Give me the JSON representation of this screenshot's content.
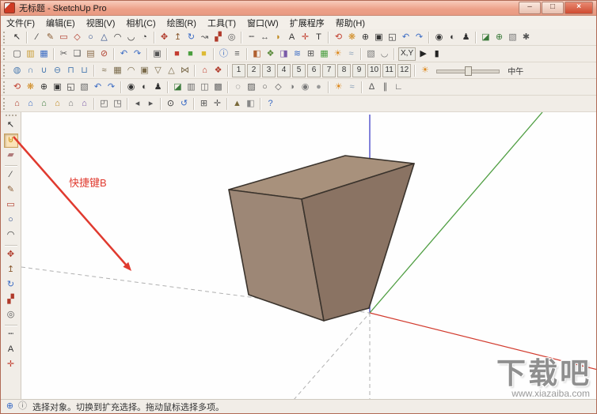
{
  "window": {
    "title": "无标题 - SketchUp Pro",
    "controls": {
      "minimize": "–",
      "maximize": "□",
      "close": "×"
    }
  },
  "menu": {
    "items": [
      {
        "n": "menu-file",
        "g": "文件(F)"
      },
      {
        "n": "menu-edit",
        "g": "编辑(E)"
      },
      {
        "n": "menu-view",
        "g": "视图(V)"
      },
      {
        "n": "menu-camera",
        "g": "相机(C)"
      },
      {
        "n": "menu-draw",
        "g": "绘图(R)"
      },
      {
        "n": "menu-tools",
        "g": "工具(T)"
      },
      {
        "n": "menu-window",
        "g": "窗口(W)"
      },
      {
        "n": "menu-extensions",
        "g": "扩展程序"
      },
      {
        "n": "menu-help",
        "g": "帮助(H)"
      }
    ]
  },
  "toolbars": {
    "row1": [
      {
        "grip": true
      },
      {
        "n": "select-tool",
        "g": "↖",
        "c": "#222222"
      },
      {
        "sep": true
      },
      {
        "n": "line-tool",
        "g": "∕",
        "c": "#333333"
      },
      {
        "n": "freehand-tool",
        "g": "✎",
        "c": "#8a5a30"
      },
      {
        "n": "rectangle-tool",
        "g": "▭",
        "c": "#b03a2a"
      },
      {
        "n": "rotated-rectangle-tool",
        "g": "◇",
        "c": "#b03a2a"
      },
      {
        "n": "circle-tool",
        "g": "○",
        "c": "#2a4a8a"
      },
      {
        "n": "polygon-tool",
        "g": "△",
        "c": "#2a4a8a"
      },
      {
        "n": "arc-tool",
        "g": "◠",
        "c": "#333333"
      },
      {
        "n": "two-point-arc-tool",
        "g": "◡",
        "c": "#333333"
      },
      {
        "n": "pie-tool",
        "g": "◔",
        "c": "#333333"
      },
      {
        "sep": true
      },
      {
        "n": "move-tool",
        "g": "✥",
        "c": "#b03a2a"
      },
      {
        "n": "push-pull-tool",
        "g": "↥",
        "c": "#8a5a30"
      },
      {
        "n": "rotate-tool",
        "g": "↻",
        "c": "#3a6bc4"
      },
      {
        "n": "follow-me-tool",
        "g": "↝",
        "c": "#555555"
      },
      {
        "n": "scale-tool",
        "g": "▞",
        "c": "#b03a2a"
      },
      {
        "n": "offset-tool",
        "g": "◎",
        "c": "#555555"
      },
      {
        "sep": true
      },
      {
        "n": "tape-measure-tool",
        "g": "┉",
        "c": "#555555"
      },
      {
        "n": "dimension-tool",
        "g": "↔",
        "c": "#555555"
      },
      {
        "n": "protractor-tool",
        "g": "◗",
        "c": "#c08a20"
      },
      {
        "n": "text-tool",
        "g": "A",
        "c": "#333333"
      },
      {
        "n": "axes-tool",
        "g": "✛",
        "c": "#c03a2a"
      },
      {
        "n": "3d-text-tool",
        "g": "T",
        "c": "#333333"
      },
      {
        "sep": true
      },
      {
        "n": "orbit-tool",
        "g": "⟲",
        "c": "#c03a2a"
      },
      {
        "n": "pan-tool",
        "g": "❋",
        "c": "#d08a20"
      },
      {
        "n": "zoom-tool",
        "g": "⊕",
        "c": "#333333"
      },
      {
        "n": "zoom-window-tool",
        "g": "▣",
        "c": "#333333"
      },
      {
        "n": "zoom-extents-tool",
        "g": "◱",
        "c": "#333333"
      },
      {
        "n": "previous-view-button",
        "g": "↶",
        "c": "#3a6bc4"
      },
      {
        "n": "next-view-button",
        "g": "↷",
        "c": "#3a6bc4"
      },
      {
        "sep": true
      },
      {
        "n": "position-camera-tool",
        "g": "◉",
        "c": "#333333"
      },
      {
        "n": "look-around-tool",
        "g": "◐",
        "c": "#333333"
      },
      {
        "n": "walk-tool",
        "g": "♟",
        "c": "#333333"
      },
      {
        "sep": true
      },
      {
        "n": "section-plane-tool",
        "g": "◪",
        "c": "#3a7a3a"
      },
      {
        "n": "add-location-button",
        "g": "⊕",
        "c": "#3a7a3a"
      },
      {
        "n": "photo-textures-button",
        "g": "▧",
        "c": "#777777"
      },
      {
        "n": "preferences-button",
        "g": "✱",
        "c": "#555555"
      }
    ],
    "row2": [
      {
        "grip": true
      },
      {
        "n": "new-button",
        "g": "▢",
        "c": "#555555"
      },
      {
        "n": "open-button",
        "g": "▥",
        "c": "#c89a30"
      },
      {
        "n": "save-button",
        "g": "▦",
        "c": "#3a6bc4"
      },
      {
        "sep": true
      },
      {
        "n": "cut-button",
        "g": "✂",
        "c": "#555555"
      },
      {
        "n": "copy-button",
        "g": "❑",
        "c": "#555555"
      },
      {
        "n": "paste-button",
        "g": "▤",
        "c": "#8a6a4a"
      },
      {
        "n": "erase-button",
        "g": "⊘",
        "c": "#b04030"
      },
      {
        "sep": true
      },
      {
        "n": "undo-button",
        "g": "↶",
        "c": "#3a6bc4"
      },
      {
        "n": "redo-button",
        "g": "↷",
        "c": "#3a6bc4"
      },
      {
        "sep": true
      },
      {
        "n": "print-button",
        "g": "▣",
        "c": "#555555"
      },
      {
        "sep": true
      },
      {
        "n": "material-red-swatch",
        "g": "■",
        "c": "#c43b30"
      },
      {
        "n": "material-green-swatch",
        "g": "■",
        "c": "#4a9e3f"
      },
      {
        "n": "material-yellow-swatch",
        "g": "■",
        "c": "#ddba35"
      },
      {
        "sep": true
      },
      {
        "n": "model-info-button",
        "g": "ⓘ",
        "c": "#3a6bc4"
      },
      {
        "n": "entity-info-button",
        "g": "≡",
        "c": "#555555"
      },
      {
        "sep": true
      },
      {
        "n": "materials-panel-button",
        "g": "◧",
        "c": "#b06030"
      },
      {
        "n": "components-panel-button",
        "g": "❖",
        "c": "#5a8a3a"
      },
      {
        "n": "styles-panel-button",
        "g": "◨",
        "c": "#7a5aa8"
      },
      {
        "n": "layers-panel-button",
        "g": "≋",
        "c": "#3a6bc4"
      },
      {
        "n": "outliner-panel-button",
        "g": "⊞",
        "c": "#555555"
      },
      {
        "n": "scenes-panel-button",
        "g": "▦",
        "c": "#4a9e3f"
      },
      {
        "n": "shadows-panel-button",
        "g": "☀",
        "c": "#dd8a20"
      },
      {
        "n": "fog-panel-button",
        "g": "≈",
        "c": "#8aa0b8"
      },
      {
        "sep": true
      },
      {
        "n": "match-photo-button",
        "g": "▧",
        "c": "#777777"
      },
      {
        "n": "soften-edges-button",
        "g": "◡",
        "c": "#777777"
      },
      {
        "sep": true
      },
      {
        "n": "coords-label",
        "g": "X,Y",
        "c": "#333333",
        "wide": true,
        "i": false
      },
      {
        "n": "play-animation-button",
        "g": "▶",
        "c": "#222222"
      },
      {
        "n": "pause-animation-button",
        "g": "▮",
        "c": "#222222"
      }
    ],
    "row3": {
      "items": [
        {
          "grip": true
        },
        {
          "n": "outer-shell-tool",
          "g": "◍",
          "c": "#4a7ab0"
        },
        {
          "n": "intersect-tool",
          "g": "∩",
          "c": "#4a7ab0"
        },
        {
          "n": "union-tool",
          "g": "∪",
          "c": "#4a7ab0"
        },
        {
          "n": "subtract-tool",
          "g": "⊖",
          "c": "#4a7ab0"
        },
        {
          "n": "trim-tool",
          "g": "⊓",
          "c": "#4a7ab0"
        },
        {
          "n": "split-tool",
          "g": "⊔",
          "c": "#4a7ab0"
        },
        {
          "sep": true
        },
        {
          "n": "from-contours-tool",
          "g": "≈",
          "c": "#7a6a4a"
        },
        {
          "n": "from-scratch-tool",
          "g": "▦",
          "c": "#7a6a4a"
        },
        {
          "n": "smoove-tool",
          "g": "◠",
          "c": "#7a6a4a"
        },
        {
          "n": "stamp-tool",
          "g": "▣",
          "c": "#7a6a4a"
        },
        {
          "n": "drape-tool",
          "g": "▽",
          "c": "#7a6a4a"
        },
        {
          "n": "add-detail-tool",
          "g": "△",
          "c": "#7a6a4a"
        },
        {
          "n": "flip-edge-tool",
          "g": "⋈",
          "c": "#7a6a4a"
        },
        {
          "sep": true
        },
        {
          "n": "3d-warehouse-button",
          "g": "⌂",
          "c": "#c03a2a"
        },
        {
          "n": "extension-warehouse-button",
          "g": "❖",
          "c": "#b03a2a"
        },
        {
          "sep": true
        },
        {
          "n": "scene-tab-1",
          "g": "1",
          "wide": true,
          "c": "#333333"
        },
        {
          "n": "scene-tab-2",
          "g": "2",
          "wide": true,
          "c": "#333333"
        },
        {
          "n": "scene-tab-3",
          "g": "3",
          "wide": true,
          "c": "#333333"
        },
        {
          "n": "scene-tab-4",
          "g": "4",
          "wide": true,
          "c": "#333333"
        },
        {
          "n": "scene-tab-5",
          "g": "5",
          "wide": true,
          "c": "#333333"
        },
        {
          "n": "scene-tab-6",
          "g": "6",
          "wide": true,
          "c": "#333333"
        },
        {
          "n": "scene-tab-7",
          "g": "7",
          "wide": true,
          "c": "#333333"
        },
        {
          "n": "scene-tab-8",
          "g": "8",
          "wide": true,
          "c": "#333333"
        },
        {
          "n": "scene-tab-9",
          "g": "9",
          "wide": true,
          "c": "#333333"
        },
        {
          "n": "scene-tab-10",
          "g": "10",
          "wide": true,
          "c": "#333333"
        },
        {
          "n": "scene-tab-11",
          "g": "11",
          "wide": true,
          "c": "#333333"
        },
        {
          "n": "scene-tab-12",
          "g": "12",
          "wide": true,
          "c": "#333333"
        },
        {
          "sep": true
        },
        {
          "n": "shadow-toggle-button",
          "g": "☀",
          "c": "#dd8a20"
        }
      ],
      "time_label": "中午"
    },
    "row4": [
      {
        "grip": true
      },
      {
        "n": "orbit-tool",
        "g": "⟲",
        "c": "#c03a2a"
      },
      {
        "n": "pan-tool",
        "g": "❋",
        "c": "#d08a20"
      },
      {
        "n": "zoom-tool",
        "g": "⊕",
        "c": "#333333"
      },
      {
        "n": "zoom-window-tool",
        "g": "▣",
        "c": "#333333"
      },
      {
        "n": "zoom-extents-tool",
        "g": "◱",
        "c": "#333333"
      },
      {
        "n": "zoom-photo-tool",
        "g": "▧",
        "c": "#666666"
      },
      {
        "n": "previous-view-button",
        "g": "↶",
        "c": "#3a6bc4"
      },
      {
        "n": "next-view-button",
        "g": "↷",
        "c": "#3a6bc4"
      },
      {
        "sep": true
      },
      {
        "n": "position-camera-tool",
        "g": "◉",
        "c": "#333333"
      },
      {
        "n": "look-around-tool",
        "g": "◐",
        "c": "#333333"
      },
      {
        "n": "walk-tool",
        "g": "♟",
        "c": "#333333"
      },
      {
        "sep": true
      },
      {
        "n": "section-plane-tool",
        "g": "◪",
        "c": "#3a7a3a"
      },
      {
        "n": "display-section-planes-button",
        "g": "▥",
        "c": "#666666"
      },
      {
        "n": "display-section-cuts-button",
        "g": "◫",
        "c": "#666666"
      },
      {
        "n": "display-section-fill-button",
        "g": "▩",
        "c": "#666666"
      },
      {
        "sep": true
      },
      {
        "n": "xray-style-button",
        "g": "◌",
        "c": "#555555"
      },
      {
        "n": "back-edges-style-button",
        "g": "▨",
        "c": "#555555"
      },
      {
        "n": "wireframe-style-button",
        "g": "○",
        "c": "#555555"
      },
      {
        "n": "hidden-line-style-button",
        "g": "◇",
        "c": "#555555"
      },
      {
        "n": "shaded-style-button",
        "g": "◑",
        "c": "#777777"
      },
      {
        "n": "textured-style-button",
        "g": "◉",
        "c": "#777777"
      },
      {
        "n": "monochrome-style-button",
        "g": "●",
        "c": "#999999"
      },
      {
        "sep": true
      },
      {
        "n": "shadows-toggle-button",
        "g": "☀",
        "c": "#dd8a20"
      },
      {
        "n": "fog-toggle-button",
        "g": "≈",
        "c": "#8aa0b8"
      },
      {
        "sep": true
      },
      {
        "n": "perspective-button",
        "g": "∆",
        "c": "#555555"
      },
      {
        "n": "parallel-projection-button",
        "g": "∥",
        "c": "#555555"
      },
      {
        "n": "two-point-perspective-button",
        "g": "∟",
        "c": "#555555"
      }
    ],
    "row5": [
      {
        "grip": true
      },
      {
        "n": "iso-view-button",
        "g": "⌂",
        "c": "#b03a2a"
      },
      {
        "n": "top-view-button",
        "g": "⌂",
        "c": "#3a6bc4"
      },
      {
        "n": "front-view-button",
        "g": "⌂",
        "c": "#3a7a3a"
      },
      {
        "n": "right-view-button",
        "g": "⌂",
        "c": "#c08a20"
      },
      {
        "n": "back-view-button",
        "g": "⌂",
        "c": "#777777"
      },
      {
        "n": "left-view-button",
        "g": "⌂",
        "c": "#7a5aa8"
      },
      {
        "sep": true
      },
      {
        "n": "hide-rest-of-model-button",
        "g": "◰",
        "c": "#555555"
      },
      {
        "n": "hide-similar-components-button",
        "g": "◳",
        "c": "#555555"
      },
      {
        "sep": true
      },
      {
        "n": "view-earlier-button",
        "g": "◂",
        "c": "#555555"
      },
      {
        "n": "view-later-button",
        "g": "▸",
        "c": "#555555"
      },
      {
        "sep": true
      },
      {
        "n": "zoom-selection-button",
        "g": "⊙",
        "c": "#333333"
      },
      {
        "n": "refresh-view-button",
        "g": "↺",
        "c": "#3a6bc4"
      },
      {
        "sep": true
      },
      {
        "n": "grid-toggle-button",
        "g": "⊞",
        "c": "#555555"
      },
      {
        "n": "snap-toggle-button",
        "g": "✛",
        "c": "#555555"
      },
      {
        "sep": true
      },
      {
        "n": "terrain-toggle-button",
        "g": "▲",
        "c": "#7a6a3a"
      },
      {
        "n": "building-maker-button",
        "g": "◧",
        "c": "#888888"
      },
      {
        "sep": true
      },
      {
        "n": "help-button",
        "g": "?",
        "c": "#3a6bc4"
      }
    ]
  },
  "left_toolbar": {
    "items": [
      {
        "grip": true
      },
      {
        "n": "select-tool",
        "g": "↖",
        "c": "#222222"
      },
      {
        "n": "paint-bucket-tool",
        "g": "⊎",
        "c": "#c89010",
        "active": true
      },
      {
        "n": "eraser-tool",
        "g": "▰",
        "c": "#b07a7a"
      },
      {
        "sep": true
      },
      {
        "n": "line-tool",
        "g": "∕",
        "c": "#333333"
      },
      {
        "n": "freehand-tool",
        "g": "✎",
        "c": "#8a5a30"
      },
      {
        "n": "rectangle-tool",
        "g": "▭",
        "c": "#b03a2a"
      },
      {
        "n": "circle-tool",
        "g": "○",
        "c": "#2a4a8a"
      },
      {
        "n": "arc-tool",
        "g": "◠",
        "c": "#333333"
      },
      {
        "sep": true
      },
      {
        "n": "move-tool",
        "g": "✥",
        "c": "#b03a2a"
      },
      {
        "n": "push-pull-tool",
        "g": "↥",
        "c": "#8a5a30"
      },
      {
        "n": "rotate-tool",
        "g": "↻",
        "c": "#3a6bc4"
      },
      {
        "n": "scale-tool",
        "g": "▞",
        "c": "#b03a2a"
      },
      {
        "n": "offset-tool",
        "g": "◎",
        "c": "#555555"
      },
      {
        "sep": true
      },
      {
        "n": "tape-measure-tool",
        "g": "┉",
        "c": "#555555"
      },
      {
        "n": "text-tool",
        "g": "A",
        "c": "#333333"
      },
      {
        "n": "axes-tool",
        "g": "✛",
        "c": "#c03a2a"
      }
    ]
  },
  "canvas": {
    "axes": {
      "red": "#d23b2e",
      "green": "#4f9e42",
      "blue": "#4040c8",
      "dashed": "#b0b0b0"
    },
    "cube": {
      "top": "#a8917c",
      "front": "#9d8776",
      "right": "#8a7363",
      "edge": "#3a332c"
    },
    "annotation": {
      "text": "快捷键B",
      "color": "#e03a2f"
    }
  },
  "statusbar": {
    "icons": [
      {
        "n": "geolocation-icon",
        "g": "⊕",
        "c": "#3a6bc4"
      },
      {
        "n": "credits-icon",
        "g": "ⓘ",
        "c": "#777777"
      }
    ],
    "text": "选择对象。切换到扩充选择。拖动鼠标选择多项。"
  },
  "watermark": {
    "title": "下载吧",
    "url": "www.xiazaiba.com"
  }
}
